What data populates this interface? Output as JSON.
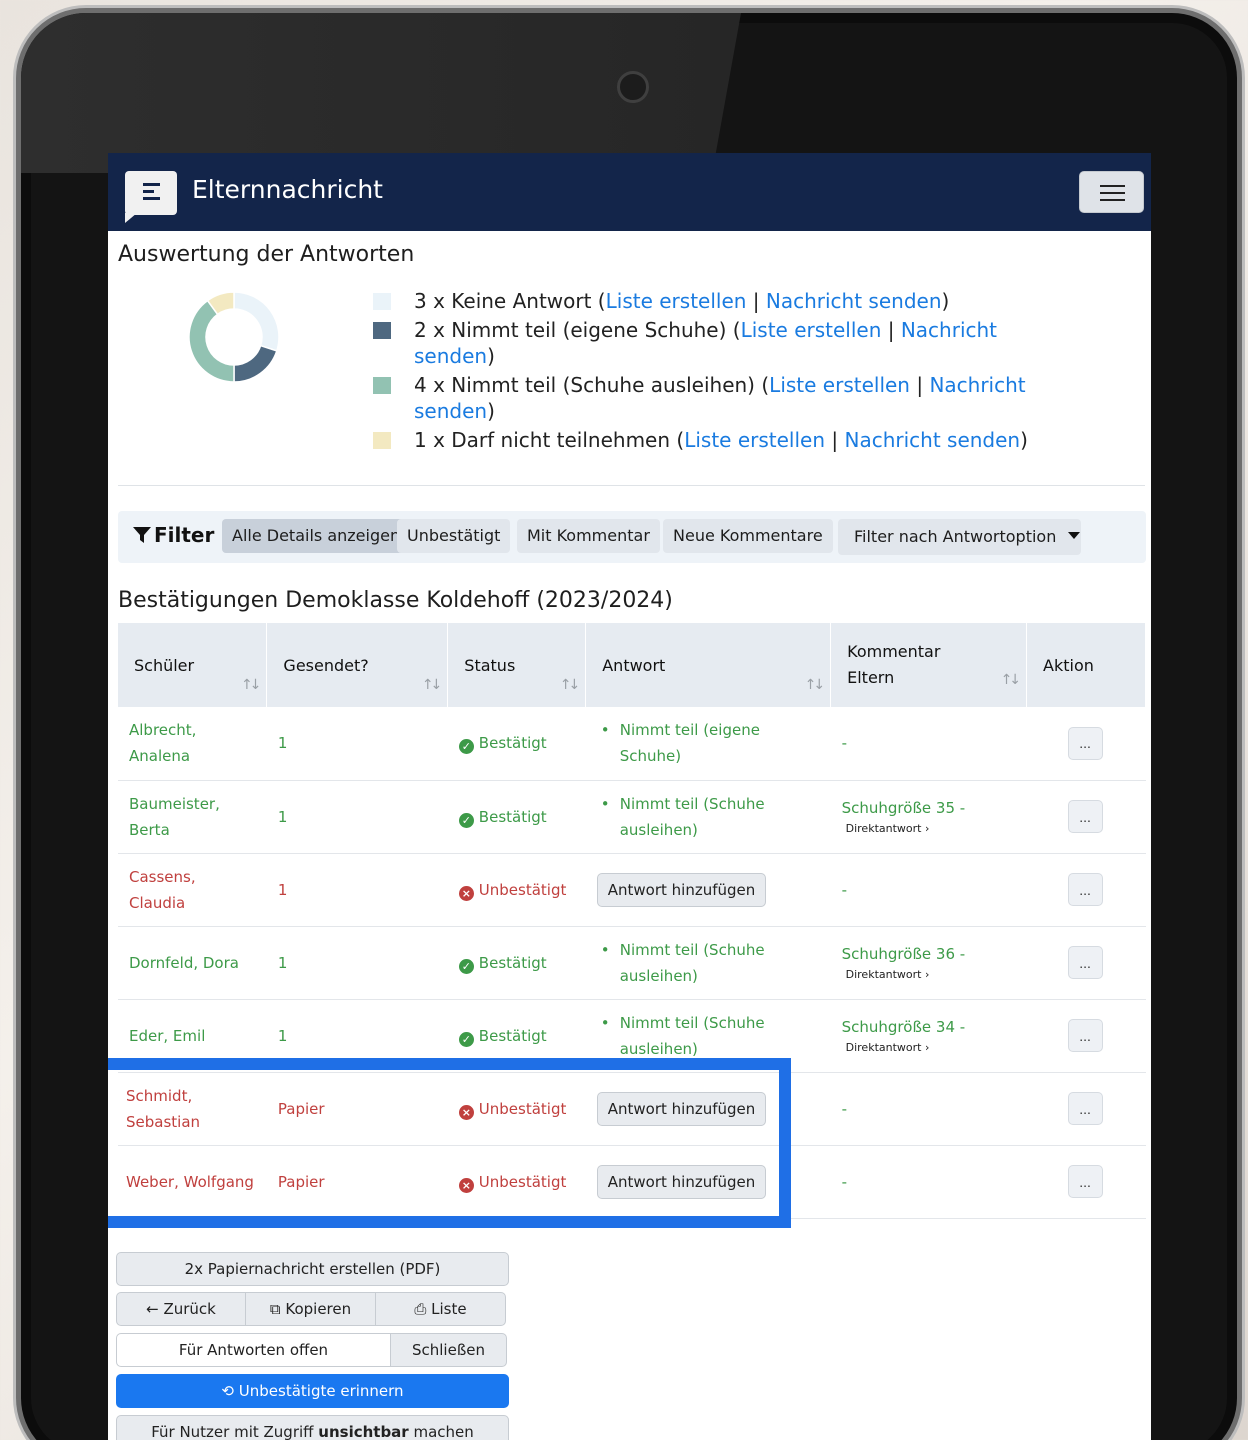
{
  "app": {
    "title": "Elternnachricht"
  },
  "evaluation": {
    "title": "Auswertung der Antworten",
    "link_list": "Liste erstellen",
    "link_message": "Nachricht senden",
    "items": [
      {
        "count_text": "3 x Keine Antwort",
        "value": 3,
        "color": "#eaf3f9"
      },
      {
        "count_text": "2 x Nimmt teil (eigene Schuhe)",
        "value": 2,
        "color": "#4e6880"
      },
      {
        "count_text": "4 x Nimmt teil (Schuhe ausleihen)",
        "value": 4,
        "color": "#92c2b2"
      },
      {
        "count_text": "1 x Darf nicht teilnehmen",
        "value": 1,
        "color": "#f3e9c1"
      }
    ]
  },
  "filter": {
    "label": "Filter",
    "buttons": [
      "Alle Details anzeigen",
      "Unbestätigt",
      "Mit Kommentar",
      "Neue Kommentare"
    ],
    "dropdown": "Filter nach Antwortoption"
  },
  "table": {
    "title": "Bestätigungen Demoklasse Koldehoff (2023/2024)",
    "headers": [
      "Schüler",
      "Gesendet?",
      "Status",
      "Antwort",
      "Kommentar Eltern",
      "Aktion"
    ],
    "sort_glyph": "↑↓",
    "rows": [
      {
        "name": "Albrecht, Analena",
        "sent": "1",
        "status": "Bestätigt",
        "answer": "Nimmt teil (eigene Schuhe)",
        "comment": "-",
        "direct": "",
        "action": "..."
      },
      {
        "name": "Baumeister, Berta",
        "sent": "1",
        "status": "Bestätigt",
        "answer": "Nimmt teil (Schuhe ausleihen)",
        "comment": "Schuhgröße 35 -",
        "direct": "Direktantwort ›",
        "action": "..."
      },
      {
        "name": "Cassens, Claudia",
        "sent": "1",
        "status": "Unbestätigt",
        "answer_button": "Antwort hinzufügen",
        "comment": "-",
        "direct": "",
        "action": "..."
      },
      {
        "name": "Dornfeld, Dora",
        "sent": "1",
        "status": "Bestätigt",
        "answer": "Nimmt teil (Schuhe ausleihen)",
        "comment": "Schuhgröße 36 -",
        "direct": "Direktantwort ›",
        "action": "..."
      },
      {
        "name": "Eder, Emil",
        "sent": "1",
        "status": "Bestätigt",
        "answer": "Nimmt teil (Schuhe ausleihen)",
        "comment": "Schuhgröße 34 -",
        "direct": "Direktantwort ›",
        "action": "..."
      },
      {
        "name": "Schmidt, Sebastian",
        "sent": "Papier",
        "status": "Unbestätigt",
        "answer_button": "Antwort hinzufügen",
        "comment": "-",
        "direct": "",
        "action": "..."
      },
      {
        "name": "Weber, Wolfgang",
        "sent": "Papier",
        "status": "Unbestätigt",
        "answer_button": "Antwort hinzufügen",
        "comment": "-",
        "direct": "",
        "action": "..."
      }
    ]
  },
  "actions": {
    "paper_pdf": "2x Papiernachricht erstellen (PDF)",
    "back": "Zurück",
    "copy": "Kopieren",
    "list": "Liste",
    "open_label": "Für Antworten offen",
    "close": "Schließen",
    "remind": "Unbestätigte erinnern",
    "invisible_prefix": "Für Nutzer mit Zugriff ",
    "invisible_bold": "unsichtbar",
    "invisible_suffix": " machen"
  }
}
